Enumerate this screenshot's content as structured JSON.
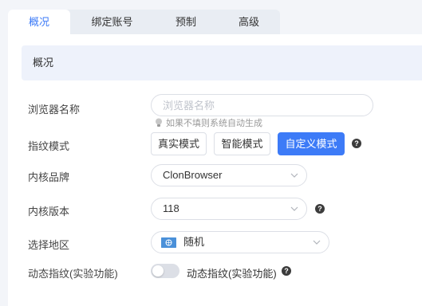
{
  "tabs": [
    {
      "label": "概况",
      "active": true
    },
    {
      "label": "绑定账号",
      "active": false
    },
    {
      "label": "预制",
      "active": false
    },
    {
      "label": "高级",
      "active": false
    }
  ],
  "section_title": "概况",
  "browser_name": {
    "label": "浏览器名称",
    "placeholder": "浏览器名称",
    "value": "",
    "hint": "如果不填则系统自动生成"
  },
  "fingerprint_mode": {
    "label": "指纹模式",
    "options": [
      "真实模式",
      "智能模式",
      "自定义模式"
    ],
    "selected": "自定义模式"
  },
  "kernel_brand": {
    "label": "内核品牌",
    "value": "ClonBrowser"
  },
  "kernel_version": {
    "label": "内核版本",
    "value": "118"
  },
  "region": {
    "label": "选择地区",
    "value": "随机"
  },
  "dynamic_fingerprint": {
    "label": "动态指纹(实验功能)",
    "toggle_label": "动态指纹(实验功能)",
    "enabled": false
  },
  "colors": {
    "accent": "#3d7bf7",
    "section_bg": "#eef2fb"
  },
  "icons": {
    "help": "question-circle-icon",
    "hint": "lightbulb-icon",
    "dropdown": "chevron-down-icon",
    "flag": "un-flag-icon"
  }
}
